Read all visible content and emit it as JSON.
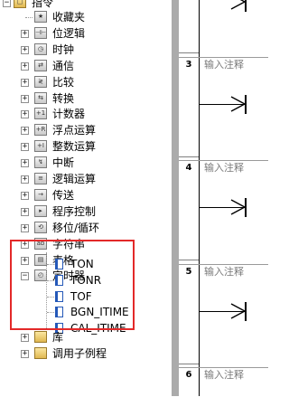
{
  "tree": {
    "root": "指令",
    "items": [
      {
        "label": "收藏夹",
        "icon": "favorites-icon",
        "expander": ""
      },
      {
        "label": "位逻辑",
        "icon": "bit-logic-icon",
        "expander": "+"
      },
      {
        "label": "时钟",
        "icon": "clock-icon",
        "expander": "+"
      },
      {
        "label": "通信",
        "icon": "communication-icon",
        "expander": "+"
      },
      {
        "label": "比较",
        "icon": "compare-icon",
        "expander": "+"
      },
      {
        "label": "转换",
        "icon": "convert-icon",
        "expander": "+"
      },
      {
        "label": "计数器",
        "icon": "counter-icon",
        "expander": "+"
      },
      {
        "label": "浮点运算",
        "icon": "float-math-icon",
        "expander": "+"
      },
      {
        "label": "整数运算",
        "icon": "integer-math-icon",
        "expander": "+"
      },
      {
        "label": "中断",
        "icon": "interrupt-icon",
        "expander": "+"
      },
      {
        "label": "逻辑运算",
        "icon": "logic-ops-icon",
        "expander": "+"
      },
      {
        "label": "传送",
        "icon": "move-icon",
        "expander": "+"
      },
      {
        "label": "程序控制",
        "icon": "program-control-icon",
        "expander": "+"
      },
      {
        "label": "移位/循环",
        "icon": "shift-rotate-icon",
        "expander": "+"
      },
      {
        "label": "字符串",
        "icon": "string-icon",
        "expander": "+"
      },
      {
        "label": "表格",
        "icon": "table-icon",
        "expander": "+"
      },
      {
        "label": "定时器",
        "icon": "timer-icon",
        "expander": "−"
      }
    ],
    "timer_children": [
      "TON",
      "TONR",
      "TOF",
      "BGN_ITIME",
      "CAL_ITIME"
    ],
    "bottom_items": [
      {
        "label": "库",
        "icon": "library-folder-icon",
        "expander": "+"
      },
      {
        "label": "调用子例程",
        "icon": "subroutine-folder-icon",
        "expander": "+"
      }
    ]
  },
  "ladder": {
    "networks": [
      {
        "number": "3",
        "comment": "输入注释"
      },
      {
        "number": "4",
        "comment": "输入注释"
      },
      {
        "number": "5",
        "comment": "输入注释"
      },
      {
        "number": "6",
        "comment": "输入注释"
      }
    ]
  }
}
